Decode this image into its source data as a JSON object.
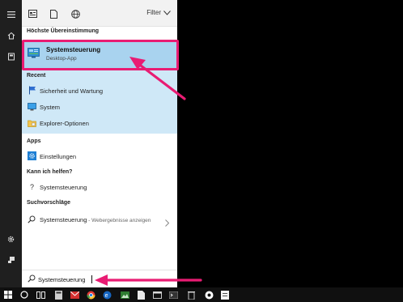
{
  "toolbar": {
    "filter_label": "Filter"
  },
  "sections": {
    "best_match": "Höchste Übereinstimmung",
    "recent": "Recent",
    "apps": "Apps",
    "help": "Kann ich helfen?",
    "suggestions": "Suchvorschläge"
  },
  "best_match": {
    "title": "Systemsteuerung",
    "subtitle": "Desktop-App"
  },
  "recent_items": [
    {
      "label": "Sicherheit und Wartung",
      "icon": "flag-icon"
    },
    {
      "label": "System",
      "icon": "monitor-icon"
    },
    {
      "label": "Explorer-Optionen",
      "icon": "folder-options-icon"
    }
  ],
  "apps_items": [
    {
      "label": "Einstellungen",
      "icon": "gear-icon"
    }
  ],
  "help_items": [
    {
      "label": "Systemsteuerung",
      "icon": "question-icon"
    }
  ],
  "suggestion": {
    "label": "Systemsteuerung",
    "sub": " - Webergebnisse anzeigen"
  },
  "search": {
    "value": "Systemsteuerung"
  },
  "colors": {
    "highlight": "#a9d3ef",
    "recent_bg": "#cfe8f7",
    "annotation": "#e91c73",
    "rail": "#1f1f1f",
    "taskbar": "#101010"
  }
}
